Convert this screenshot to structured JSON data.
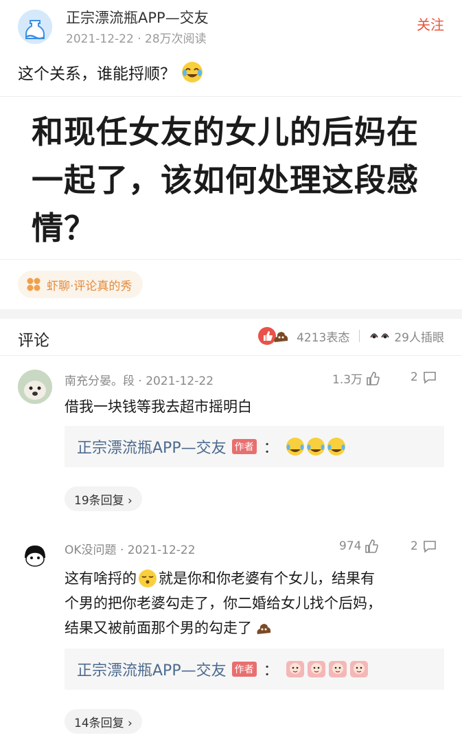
{
  "post": {
    "author": "正宗漂流瓶APP—交友",
    "date": "2021-12-22",
    "views": "28万次阅读",
    "follow_label": "关注",
    "text": "这个关系，谁能捋顺？",
    "quote": "和现任女友的女儿的后妈在一起了，该如何处理这段感情？",
    "tag": "虾聊·评论真的秀"
  },
  "comments_bar": {
    "title": "评论",
    "reactions": "4213表态",
    "peeks": "29人插眼"
  },
  "comments": [
    {
      "user": "南充分晏。段",
      "date": "2021-12-22",
      "likes": "1.3万",
      "replies_count": "2",
      "text": "借我一块钱等我去超市摇明白",
      "reply_author": "正宗漂流瓶APP—交友",
      "author_badge": "作者",
      "more_replies": "19条回复 ›"
    },
    {
      "user": "OK没问题",
      "date": "2021-12-22",
      "likes": "974",
      "replies_count": "2",
      "text_line1": "这有啥捋的",
      "text_line1b": "就是你和你老婆有个女儿，结果有",
      "text_line2": "个男的把你老婆勾走了，你二婚给女儿找个后妈，",
      "text_line3": "结果又被前面那个男的勾走了",
      "reply_author": "正宗漂流瓶APP—交友",
      "author_badge": "作者",
      "more_replies": "14条回复 ›"
    }
  ],
  "colors": {
    "accent": "#e9543c",
    "link": "#4c6a8e",
    "tag": "#e38a3c"
  }
}
